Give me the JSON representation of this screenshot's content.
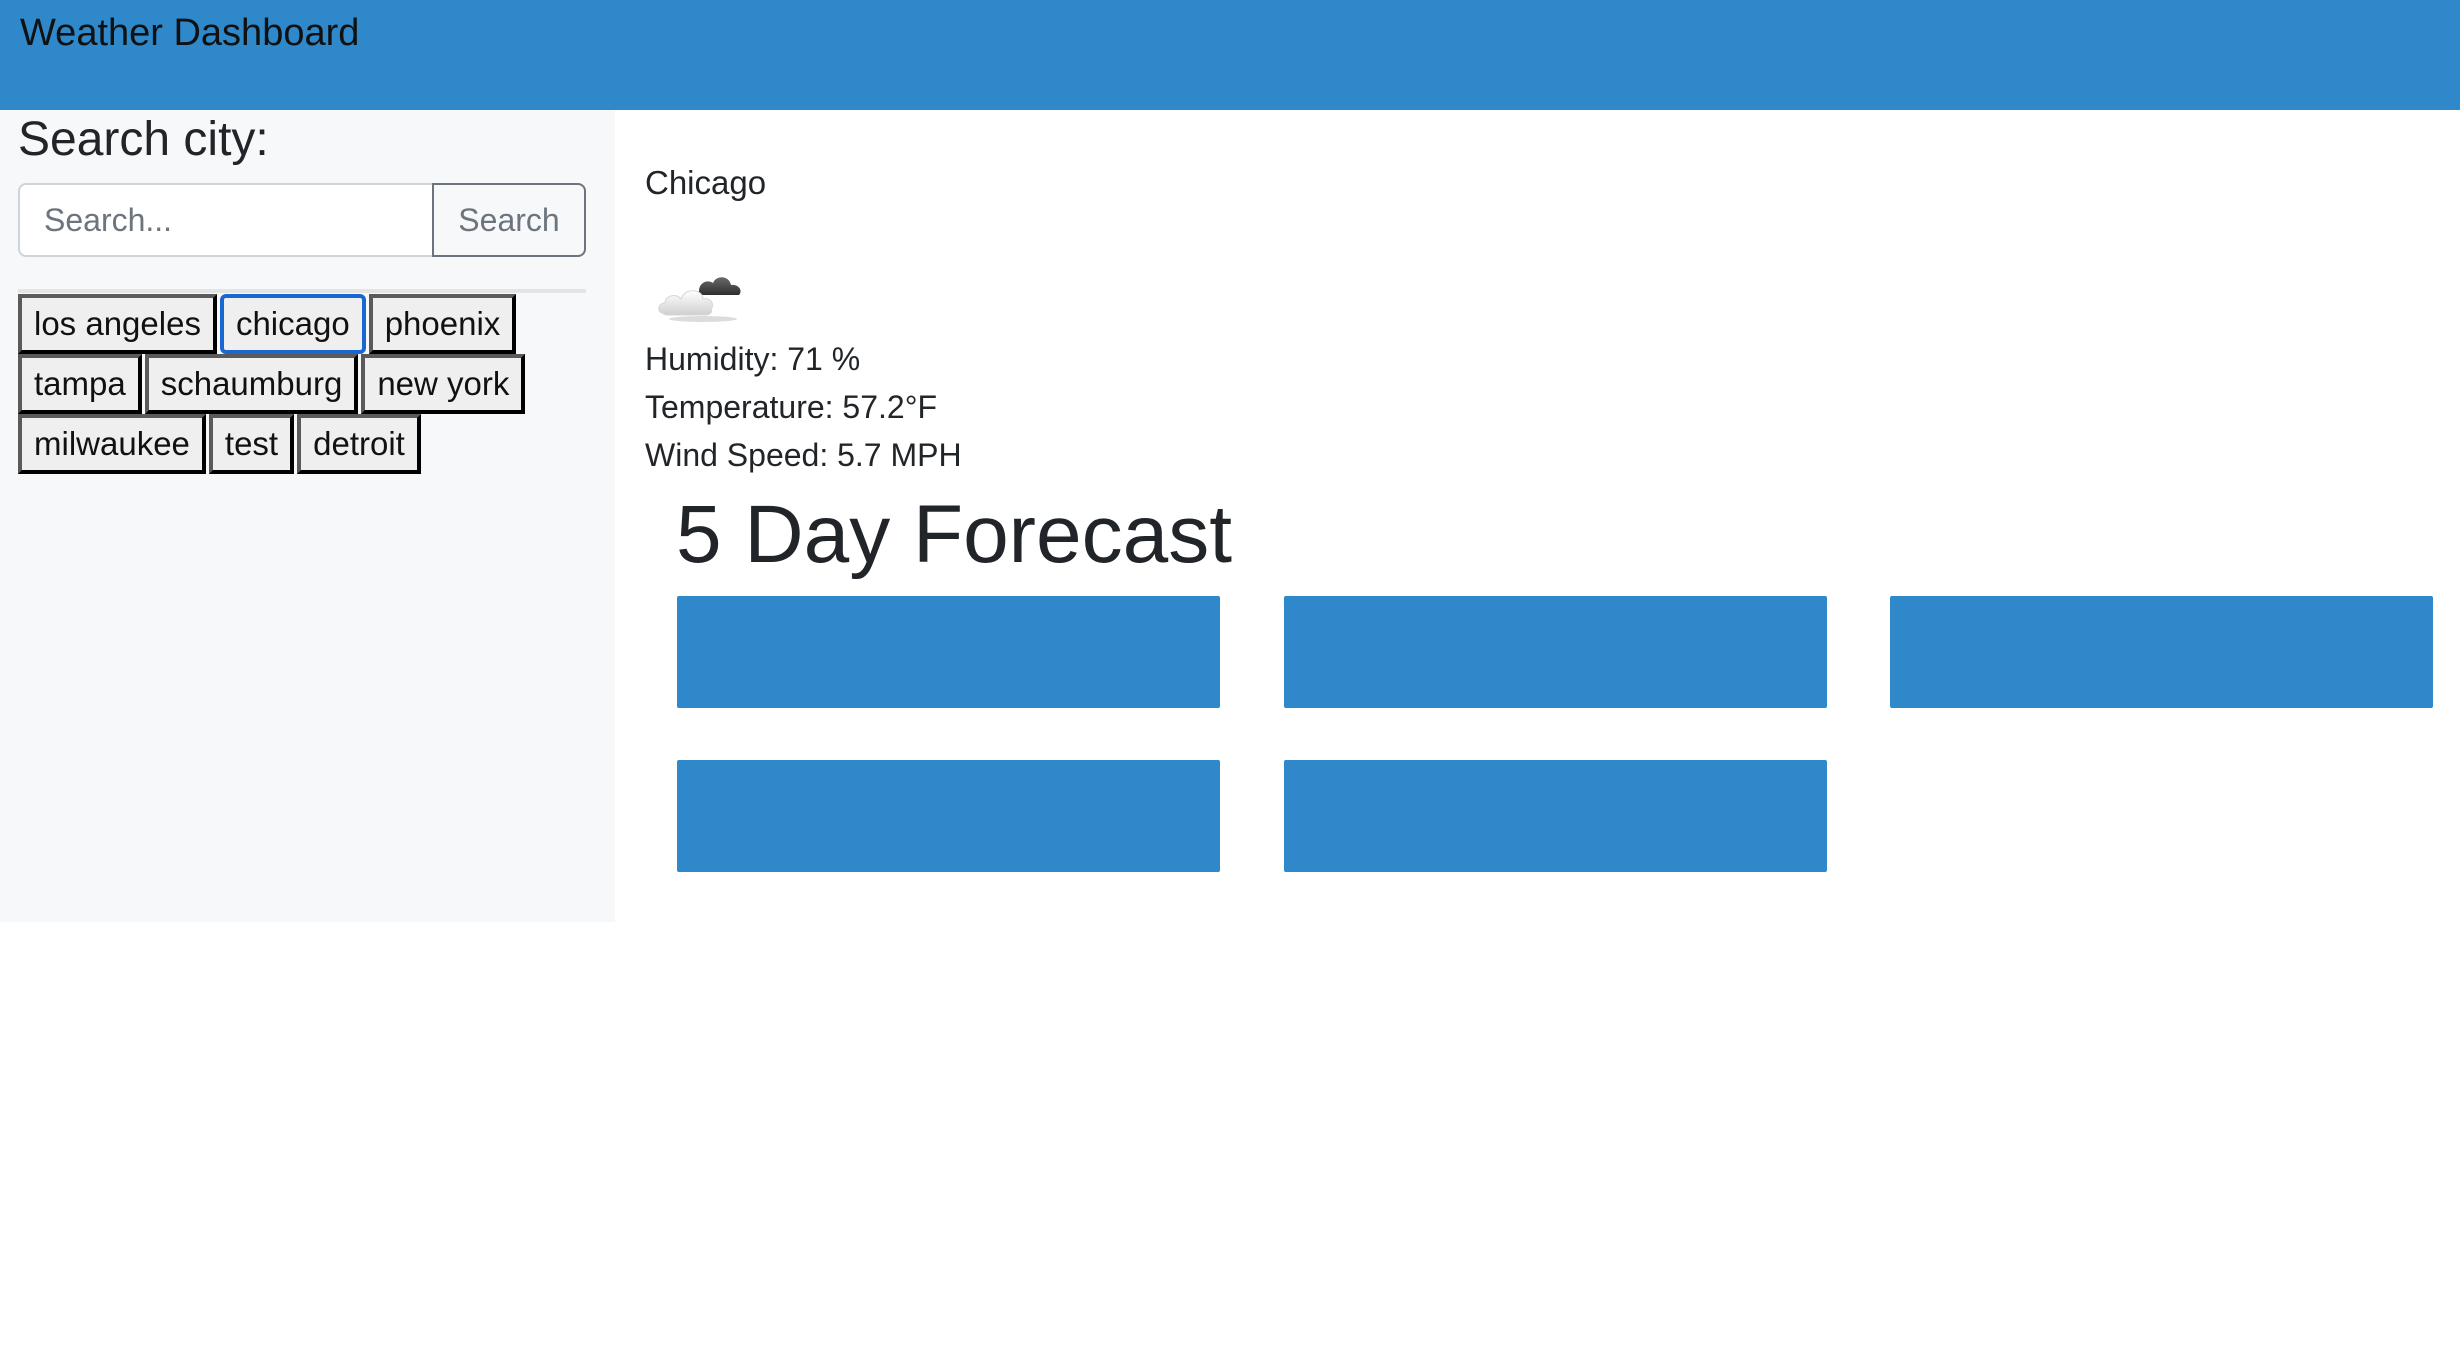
{
  "header": {
    "title": "Weather Dashboard"
  },
  "sidebar": {
    "heading": "Search city:",
    "search_placeholder": "Search...",
    "search_value": "",
    "search_button": "Search",
    "history": [
      {
        "label": "los angeles",
        "focused": false
      },
      {
        "label": "chicago",
        "focused": true
      },
      {
        "label": "phoenix",
        "focused": false
      },
      {
        "label": "tampa",
        "focused": false
      },
      {
        "label": "schaumburg",
        "focused": false
      },
      {
        "label": "new york",
        "focused": false
      },
      {
        "label": "milwaukee",
        "focused": false
      },
      {
        "label": "test",
        "focused": false
      },
      {
        "label": "detroit",
        "focused": false
      }
    ]
  },
  "current": {
    "city": "Chicago",
    "icon": "cloud-icon",
    "humidity": "Humidity: 71 %",
    "temperature": "Temperature: 57.2°F",
    "wind": "Wind Speed: 5.7 MPH"
  },
  "forecast": {
    "title": "5 Day Forecast",
    "cards": [
      {},
      {},
      {},
      {},
      {}
    ]
  },
  "colors": {
    "accent": "#2e88c9",
    "sidebar_bg": "#f7f8f9",
    "focus": "#1967d2"
  }
}
